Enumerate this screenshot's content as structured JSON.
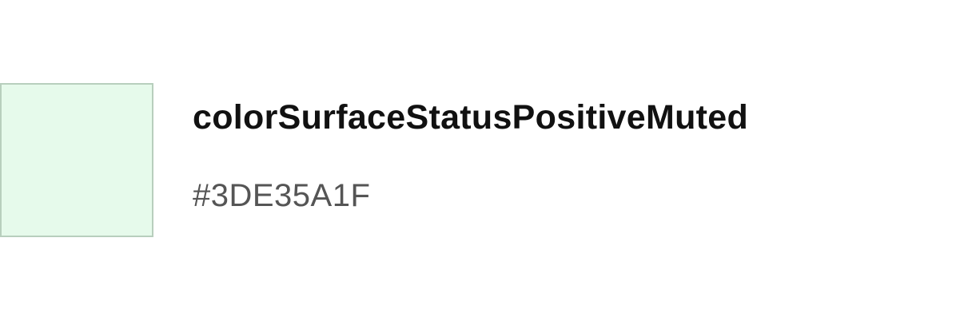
{
  "token": {
    "name": "colorSurfaceStatusPositiveMuted",
    "value": "#3DE35A1F",
    "swatch_fill": "#E6FAEB",
    "swatch_border": "#B8CFBD"
  },
  "colors": {
    "name_text": "#111111",
    "value_text": "#555555",
    "background": "#FFFFFF"
  }
}
